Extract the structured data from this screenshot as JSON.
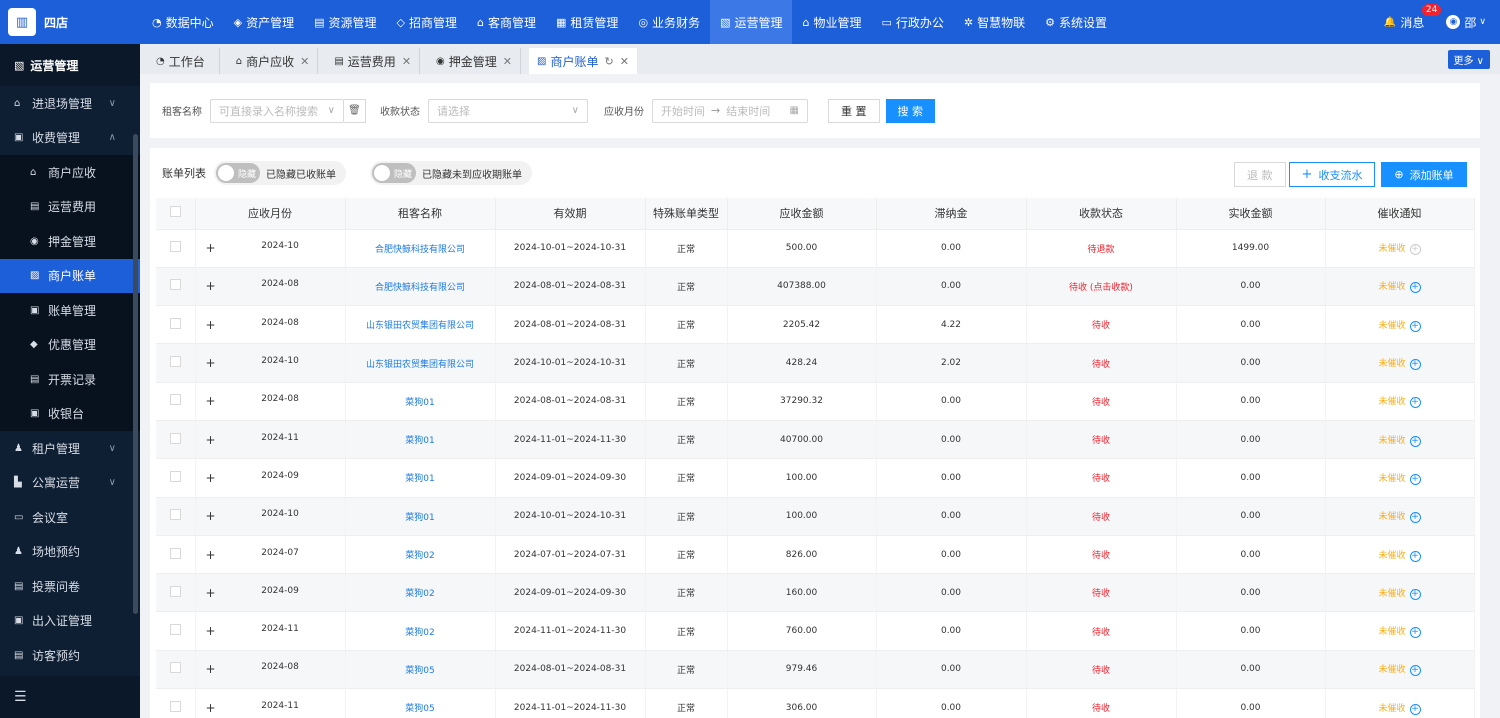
{
  "app": {
    "logo_glyph": "▥",
    "store_name": "四店"
  },
  "topnav": [
    {
      "icon": "◔",
      "label": "数据中心"
    },
    {
      "icon": "◈",
      "label": "资产管理"
    },
    {
      "icon": "▤",
      "label": "资源管理"
    },
    {
      "icon": "◇",
      "label": "招商管理"
    },
    {
      "icon": "⌂",
      "label": "客商管理"
    },
    {
      "icon": "▦",
      "label": "租赁管理"
    },
    {
      "icon": "◎",
      "label": "业务财务"
    },
    {
      "icon": "▧",
      "label": "运营管理"
    },
    {
      "icon": "⌂",
      "label": "物业管理"
    },
    {
      "icon": "▭",
      "label": "行政办公"
    },
    {
      "icon": "✲",
      "label": "智慧物联"
    },
    {
      "icon": "⚙",
      "label": "系统设置"
    }
  ],
  "top_right": {
    "bell": "🔔",
    "msg_label": "消息",
    "msg_count": "24",
    "user_glyph": "◉",
    "user_name": "邵",
    "user_chev": "∨"
  },
  "sidebar": {
    "head_icon": "▧",
    "head": "运营管理",
    "items_top": [
      {
        "icon": "⌂",
        "label": "进退场管理",
        "chev": "∨"
      },
      {
        "icon": "▣",
        "label": "收费管理",
        "chev": "∧"
      }
    ],
    "sub_items": [
      {
        "icon": "⌂",
        "label": "商户应收"
      },
      {
        "icon": "▤",
        "label": "运营费用"
      },
      {
        "icon": "◉",
        "label": "押金管理"
      },
      {
        "icon": "▨",
        "label": "商户账单"
      },
      {
        "icon": "▣",
        "label": "账单管理"
      },
      {
        "icon": "◆",
        "label": "优惠管理"
      },
      {
        "icon": "▤",
        "label": "开票记录"
      },
      {
        "icon": "▣",
        "label": "收银台"
      }
    ],
    "items_bottom": [
      {
        "icon": "♟",
        "label": "租户管理",
        "chev": "∨"
      },
      {
        "icon": "▙",
        "label": "公寓运营",
        "chev": "∨"
      },
      {
        "icon": "▭",
        "label": "会议室",
        "chev": ""
      },
      {
        "icon": "♟",
        "label": "场地预约",
        "chev": ""
      },
      {
        "icon": "▤",
        "label": "投票问卷",
        "chev": ""
      },
      {
        "icon": "▣",
        "label": "出入证管理",
        "chev": ""
      },
      {
        "icon": "▤",
        "label": "访客预约",
        "chev": ""
      }
    ],
    "collapse_glyph": "☰"
  },
  "tabs": [
    {
      "icon": "◔",
      "label": "工作台",
      "close": ""
    },
    {
      "icon": "⌂",
      "label": "商户应收",
      "close": "✕"
    },
    {
      "icon": "▤",
      "label": "运营费用",
      "close": "✕"
    },
    {
      "icon": "◉",
      "label": "押金管理",
      "close": "✕"
    },
    {
      "icon": "▨",
      "label": "商户账单",
      "close": "✕"
    }
  ],
  "tab_active_refresh": "↻",
  "more_label": "更多 ∨",
  "filter": {
    "tenant_label": "租客名称",
    "tenant_placeholder": "可直接录入名称搜索",
    "tenant_arrow": "∨",
    "trash_glyph": "🗑",
    "status_label": "收款状态",
    "status_placeholder": "请选择",
    "status_arrow": "∨",
    "month_label": "应收月份",
    "start_placeholder": "开始时间",
    "range_arrow": "→",
    "end_placeholder": "结束时间",
    "cal_glyph": "▦",
    "reset": "重 置",
    "search": "搜 索"
  },
  "panel": {
    "title": "账单列表",
    "switch1_text": "隐藏",
    "switch1_label": "已隐藏已收账单",
    "switch2_text": "隐藏",
    "switch2_label": "已隐藏未到应收期账单",
    "refund": "退 款",
    "flow": "收支流水",
    "flow_icon": "+",
    "add": "添加账单",
    "add_icon": "⊕"
  },
  "columns": [
    "应收月份",
    "租客名称",
    "有效期",
    "特殊账单类型",
    "应收金额",
    "滞纳金",
    "收款状态",
    "实收金额",
    "催收通知"
  ],
  "expand_glyph": "+",
  "remind_glyph": "+",
  "rows": [
    {
      "month": "2024-10",
      "tenant": "合肥快鲸科技有限公司",
      "period": "2024-10-01~2024-10-31",
      "type": "正常",
      "amount": "500.00",
      "late": "0.00",
      "status": "待退款",
      "paid": "1499.00",
      "remind": "未催收",
      "dim": true
    },
    {
      "month": "2024-08",
      "tenant": "合肥快鲸科技有限公司",
      "period": "2024-08-01~2024-08-31",
      "type": "正常",
      "amount": "407388.00",
      "late": "0.00",
      "status": "待收 (点击收款)",
      "paid": "0.00",
      "remind": "未催收",
      "dim": false
    },
    {
      "month": "2024-08",
      "tenant": "山东银田农贸集团有限公司",
      "period": "2024-08-01~2024-08-31",
      "type": "正常",
      "amount": "2205.42",
      "late": "4.22",
      "status": "待收",
      "paid": "0.00",
      "remind": "未催收",
      "dim": false
    },
    {
      "month": "2024-10",
      "tenant": "山东银田农贸集团有限公司",
      "period": "2024-10-01~2024-10-31",
      "type": "正常",
      "amount": "428.24",
      "late": "2.02",
      "status": "待收",
      "paid": "0.00",
      "remind": "未催收",
      "dim": false
    },
    {
      "month": "2024-08",
      "tenant": "菜狗01",
      "period": "2024-08-01~2024-08-31",
      "type": "正常",
      "amount": "37290.32",
      "late": "0.00",
      "status": "待收",
      "paid": "0.00",
      "remind": "未催收",
      "dim": false
    },
    {
      "month": "2024-11",
      "tenant": "菜狗01",
      "period": "2024-11-01~2024-11-30",
      "type": "正常",
      "amount": "40700.00",
      "late": "0.00",
      "status": "待收",
      "paid": "0.00",
      "remind": "未催收",
      "dim": false
    },
    {
      "month": "2024-09",
      "tenant": "菜狗01",
      "period": "2024-09-01~2024-09-30",
      "type": "正常",
      "amount": "100.00",
      "late": "0.00",
      "status": "待收",
      "paid": "0.00",
      "remind": "未催收",
      "dim": false
    },
    {
      "month": "2024-10",
      "tenant": "菜狗01",
      "period": "2024-10-01~2024-10-31",
      "type": "正常",
      "amount": "100.00",
      "late": "0.00",
      "status": "待收",
      "paid": "0.00",
      "remind": "未催收",
      "dim": false
    },
    {
      "month": "2024-07",
      "tenant": "菜狗02",
      "period": "2024-07-01~2024-07-31",
      "type": "正常",
      "amount": "826.00",
      "late": "0.00",
      "status": "待收",
      "paid": "0.00",
      "remind": "未催收",
      "dim": false
    },
    {
      "month": "2024-09",
      "tenant": "菜狗02",
      "period": "2024-09-01~2024-09-30",
      "type": "正常",
      "amount": "160.00",
      "late": "0.00",
      "status": "待收",
      "paid": "0.00",
      "remind": "未催收",
      "dim": false
    },
    {
      "month": "2024-11",
      "tenant": "菜狗02",
      "period": "2024-11-01~2024-11-30",
      "type": "正常",
      "amount": "760.00",
      "late": "0.00",
      "status": "待收",
      "paid": "0.00",
      "remind": "未催收",
      "dim": false
    },
    {
      "month": "2024-08",
      "tenant": "菜狗05",
      "period": "2024-08-01~2024-08-31",
      "type": "正常",
      "amount": "979.46",
      "late": "0.00",
      "status": "待收",
      "paid": "0.00",
      "remind": "未催收",
      "dim": false
    },
    {
      "month": "2024-11",
      "tenant": "菜狗05",
      "period": "2024-11-01~2024-11-30",
      "type": "正常",
      "amount": "306.00",
      "late": "0.00",
      "status": "待收",
      "paid": "0.00",
      "remind": "未催收",
      "dim": false
    }
  ]
}
